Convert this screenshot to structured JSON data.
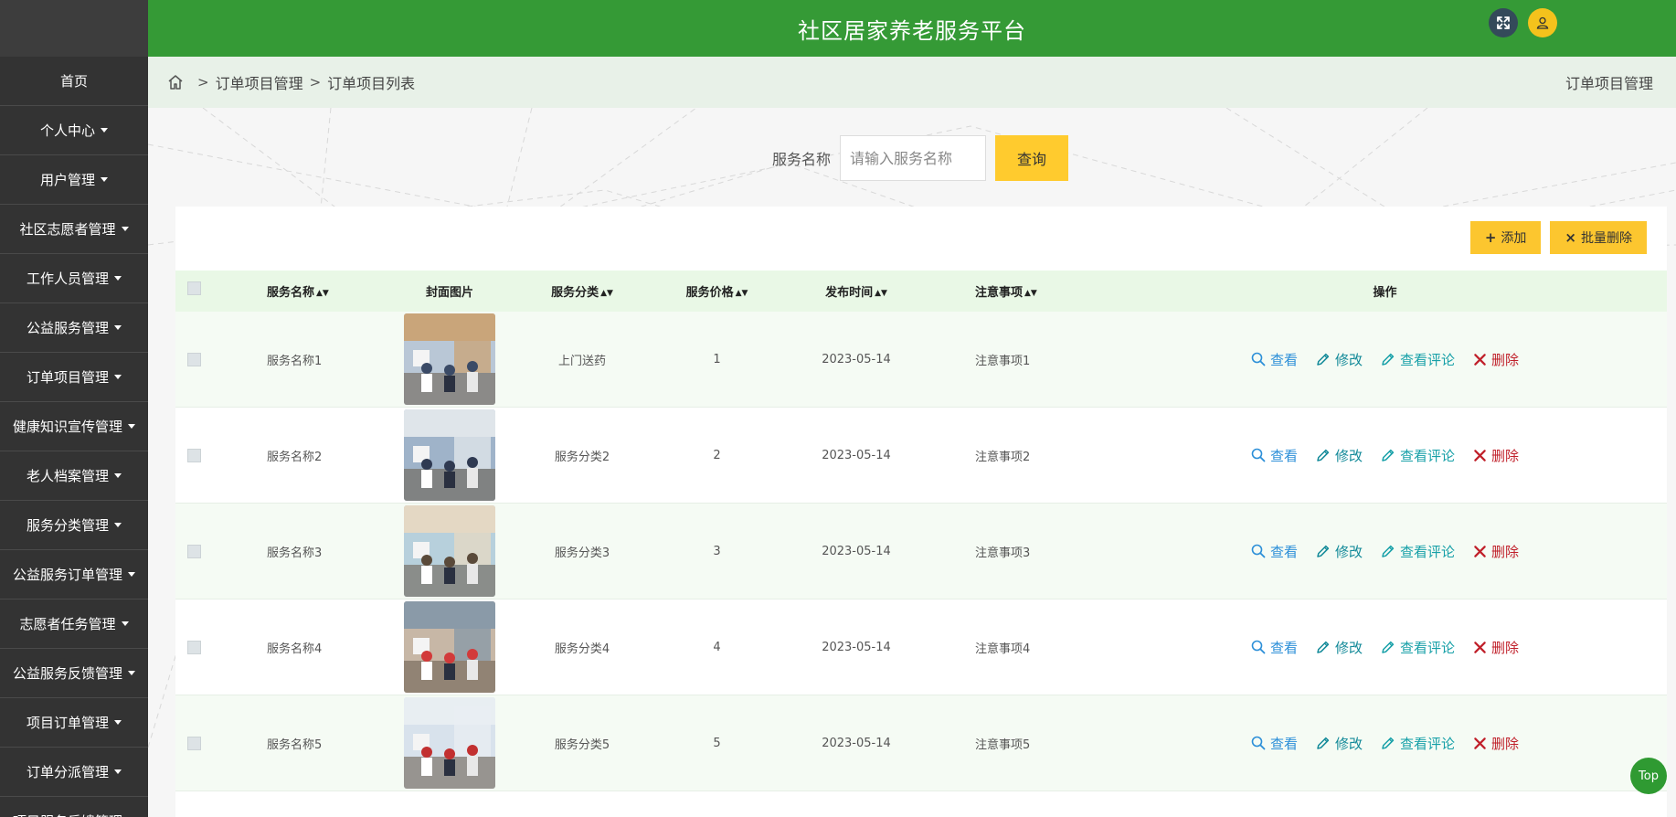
{
  "header": {
    "title": "社区居家养老服务平台"
  },
  "sidebar": {
    "items": [
      {
        "label": "首页",
        "dropdown": false
      },
      {
        "label": "个人中心",
        "dropdown": true
      },
      {
        "label": "用户管理",
        "dropdown": true
      },
      {
        "label": "社区志愿者管理",
        "dropdown": true
      },
      {
        "label": "工作人员管理",
        "dropdown": true
      },
      {
        "label": "公益服务管理",
        "dropdown": true
      },
      {
        "label": "订单项目管理",
        "dropdown": true
      },
      {
        "label": "健康知识宣传管理",
        "dropdown": true
      },
      {
        "label": "老人档案管理",
        "dropdown": true
      },
      {
        "label": "服务分类管理",
        "dropdown": true
      },
      {
        "label": "公益服务订单管理",
        "dropdown": true
      },
      {
        "label": "志愿者任务管理",
        "dropdown": true
      },
      {
        "label": "公益服务反馈管理",
        "dropdown": true
      },
      {
        "label": "项目订单管理",
        "dropdown": true
      },
      {
        "label": "订单分派管理",
        "dropdown": true
      },
      {
        "label": "项目服务反馈管理",
        "dropdown": true
      }
    ]
  },
  "breadcrumb": {
    "items": [
      "订单项目管理",
      "订单项目列表"
    ],
    "right": "订单项目管理"
  },
  "search": {
    "label": "服务名称",
    "placeholder": "请输入服务名称",
    "button": "查询"
  },
  "actions": {
    "add": "添加",
    "batch_delete": "批量删除"
  },
  "table": {
    "columns": {
      "name": "服务名称",
      "image": "封面图片",
      "category": "服务分类",
      "price": "服务价格",
      "time": "发布时间",
      "note": "注意事项",
      "ops": "操作"
    },
    "ops": {
      "view": "查看",
      "edit": "修改",
      "comments": "查看评论",
      "delete": "删除"
    },
    "rows": [
      {
        "name": "服务名称1",
        "category": "上门送药",
        "price": "1",
        "time": "2023-05-14",
        "note": "注意事项1"
      },
      {
        "name": "服务名称2",
        "category": "服务分类2",
        "price": "2",
        "time": "2023-05-14",
        "note": "注意事项2"
      },
      {
        "name": "服务名称3",
        "category": "服务分类3",
        "price": "3",
        "time": "2023-05-14",
        "note": "注意事项3"
      },
      {
        "name": "服务名称4",
        "category": "服务分类4",
        "price": "4",
        "time": "2023-05-14",
        "note": "注意事项4"
      },
      {
        "name": "服务名称5",
        "category": "服务分类5",
        "price": "5",
        "time": "2023-05-14",
        "note": "注意事项5"
      }
    ]
  },
  "top_button": "Top",
  "colors": {
    "header": "#359a36",
    "sidebar": "#333333",
    "accent": "#ffcb2e",
    "view": "#2c8fd8",
    "delete": "#c0202a"
  }
}
